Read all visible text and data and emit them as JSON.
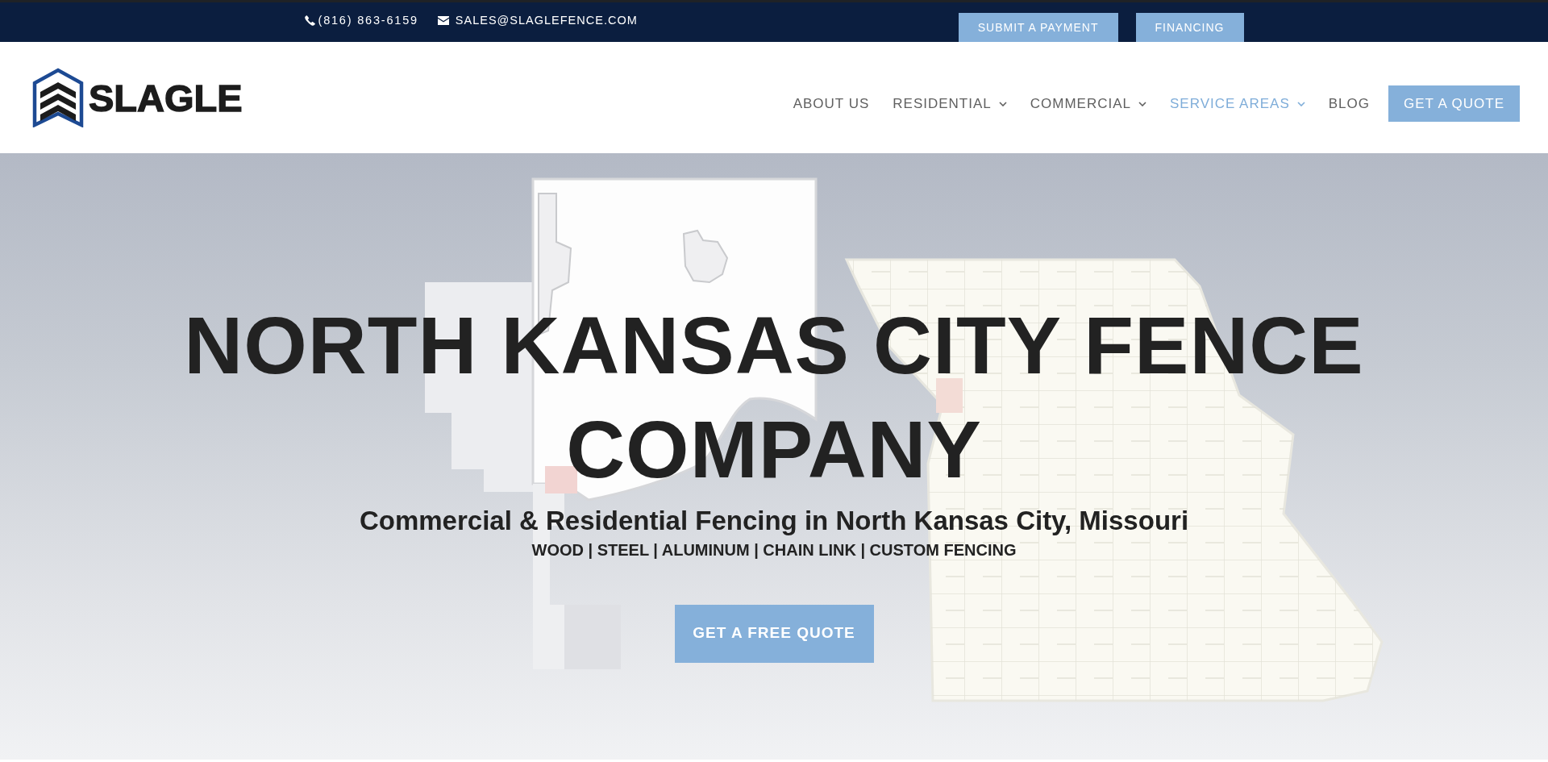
{
  "top_bar": {
    "phone": "(816) 863-6159",
    "email": "SALES@SLAGLEFENCE.COM",
    "buttons": [
      "SUBMIT A PAYMENT",
      "FINANCING"
    ]
  },
  "header": {
    "logo": "SLAGLE",
    "nav": [
      {
        "label": "ABOUT US",
        "dropdown": false,
        "selected": false
      },
      {
        "label": "RESIDENTIAL",
        "dropdown": true,
        "selected": false
      },
      {
        "label": "COMMERCIAL",
        "dropdown": true,
        "selected": false
      },
      {
        "label": "SERVICE AREAS",
        "dropdown": true,
        "selected": true
      },
      {
        "label": "BLOG",
        "dropdown": false,
        "selected": false
      }
    ],
    "cta": "GET A QUOTE"
  },
  "hero": {
    "title": "NORTH KANSAS CITY FENCE COMPANY",
    "subtitle": "Commercial & Residential Fencing in North Kansas City, Missouri",
    "tagline": "WOOD | STEEL | ALUMINUM | CHAIN LINK | CUSTOM FENCING",
    "button": "GET A FREE QUOTE"
  }
}
